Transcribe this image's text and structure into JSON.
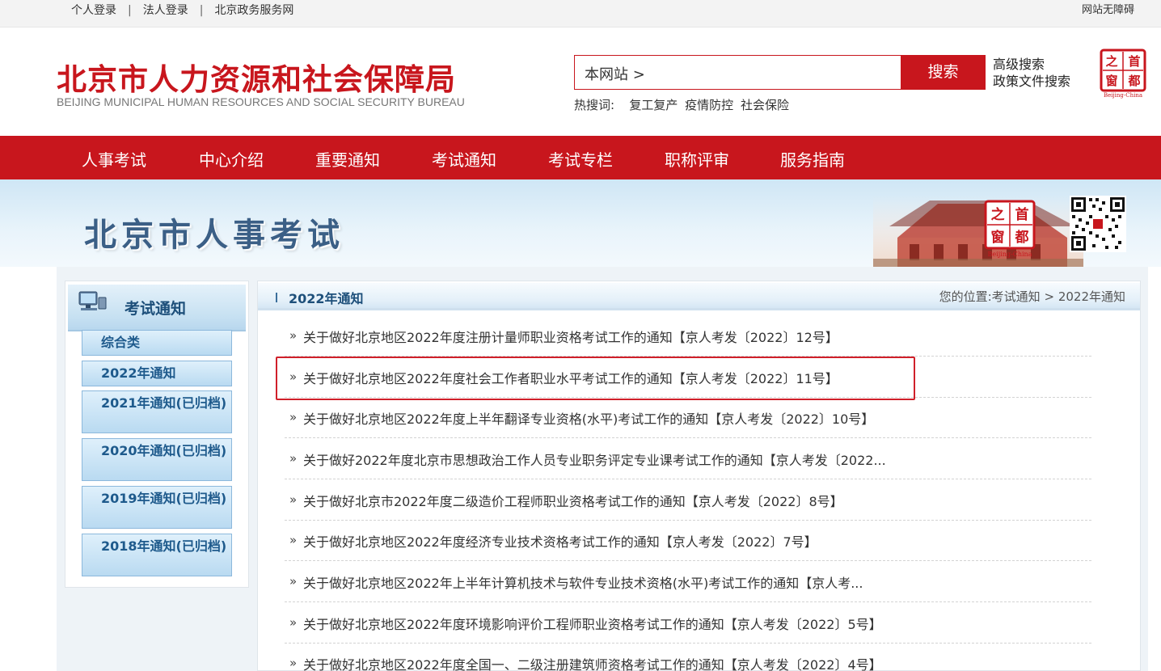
{
  "topbar": {
    "personal_login": "个人登录",
    "corp_login": "法人登录",
    "gov_service": "北京政务服务网",
    "accessibility": "网站无障碍"
  },
  "header": {
    "logo_cn": "北京市人力资源和社会保障局",
    "logo_en": "BEIJING MUNICIPAL HUMAN RESOURCES AND SOCIAL SECURITY BUREAU",
    "search_scope": "本网站 >",
    "search_button": "搜索",
    "advanced_search": "高级搜索",
    "policy_search": "政策文件搜索",
    "hot_label": "热搜词:",
    "hot_words": [
      "复工复产",
      "疫情防控",
      "社会保险"
    ],
    "seal_text": [
      "之",
      "首",
      "窗",
      "都"
    ],
    "seal_caption": "Beijing-China"
  },
  "nav": {
    "items": [
      "人事考试",
      "中心介绍",
      "重要通知",
      "考试通知",
      "考试专栏",
      "职称评审",
      "服务指南"
    ]
  },
  "banner": {
    "title": "北京市人事考试",
    "seal_caption": "Beijing-China"
  },
  "sidebar": {
    "title": "考试通知",
    "items": [
      {
        "label": "综合类"
      },
      {
        "label": "2022年通知"
      },
      {
        "label": "2021年通知(已归档)"
      },
      {
        "label": "2020年通知(已归档)"
      },
      {
        "label": "2019年通知(已归档)"
      },
      {
        "label": "2018年通知(已归档)"
      }
    ]
  },
  "main": {
    "section_title": "2022年通知",
    "breadcrumb_prefix": "您的位置:",
    "breadcrumb_parent": "考试通知",
    "breadcrumb_sep": ">",
    "breadcrumb_current": "2022年通知",
    "list_marker": "»",
    "articles": [
      "关于做好北京地区2022年度注册计量师职业资格考试工作的通知【京人考发〔2022〕12号】",
      "关于做好北京地区2022年度社会工作者职业水平考试工作的通知【京人考发〔2022〕11号】",
      "关于做好北京地区2022年度上半年翻译专业资格(水平)考试工作的通知【京人考发〔2022〕10号】",
      "关于做好2022年度北京市思想政治工作人员专业职务评定专业课考试工作的通知【京人考发〔2022...",
      "关于做好北京市2022年度二级造价工程师职业资格考试工作的通知【京人考发〔2022〕8号】",
      "关于做好北京地区2022年度经济专业技术资格考试工作的通知【京人考发〔2022〕7号】",
      "关于做好北京地区2022年上半年计算机技术与软件专业技术资格(水平)考试工作的通知【京人考...",
      "关于做好北京地区2022年度环境影响评价工程师职业资格考试工作的通知【京人考发〔2022〕5号】",
      "关于做好北京地区2022年度全国一、二级注册建筑师资格考试工作的通知【京人考发〔2022〕4号】"
    ]
  },
  "colors": {
    "brand_red": "#c8161d",
    "nav_text": "#ffffff",
    "sidebar_blue": "#1e5a8c",
    "highlight_border": "#d0202a"
  }
}
